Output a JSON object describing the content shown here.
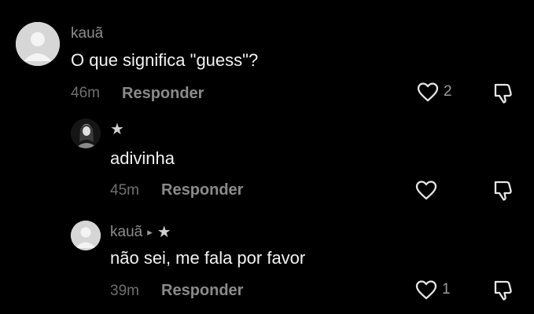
{
  "comments": [
    {
      "username": "kauã",
      "text": "O que significa \"guess\"?",
      "time": "46m",
      "reply_label": "Responder",
      "likes": "2"
    },
    {
      "username": "★",
      "text": "adivinha",
      "time": "45m",
      "reply_label": "Responder",
      "likes": ""
    },
    {
      "username": "kauã",
      "reply_marker": "▸",
      "reply_to": "★",
      "text": "não sei, me fala por favor",
      "time": "39m",
      "reply_label": "Responder",
      "likes": "1"
    }
  ],
  "icons": {
    "like": "heart-outline-icon",
    "dislike": "thumbs-down-outline-icon",
    "avatar_placeholder": "default-avatar-icon"
  },
  "colors": {
    "background": "#000000",
    "username": "#8d8d8d",
    "text": "#f2f2f2",
    "meta": "#6f6f6f"
  }
}
